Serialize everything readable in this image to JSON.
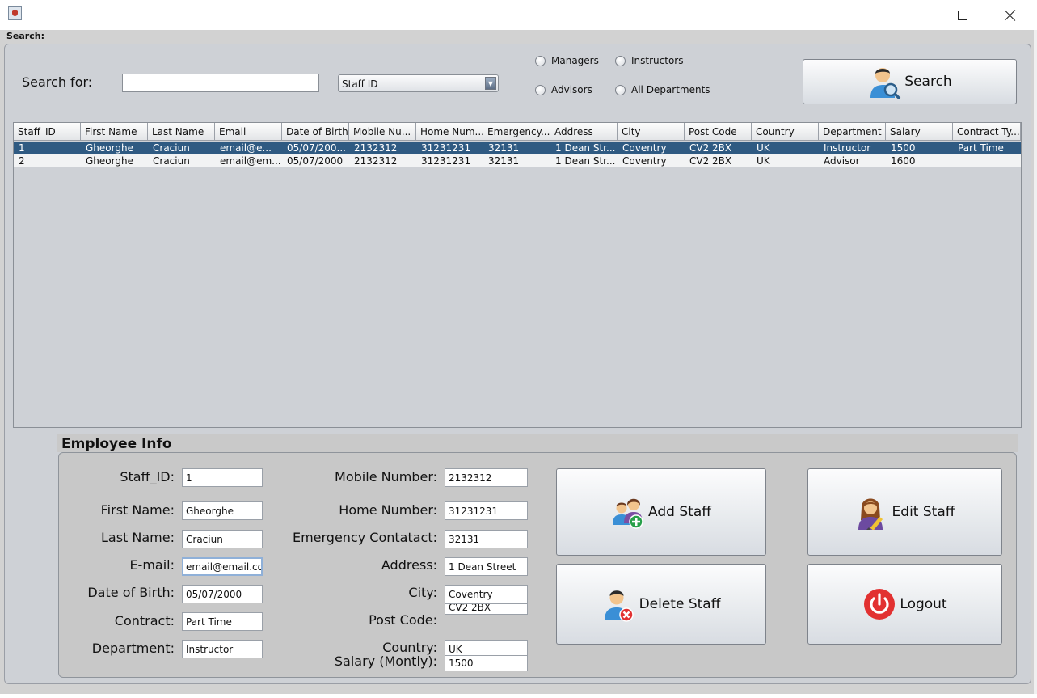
{
  "window": {
    "app_icon": "java-coffee-cup-icon"
  },
  "search": {
    "caption": "Search:",
    "label": "Search for:",
    "input_value": "",
    "field_combo": "Staff ID",
    "radios": [
      "Managers",
      "Instructors",
      "Advisors",
      "All Departments"
    ],
    "button_label": "Search",
    "button_icon": "person-magnifier-icon"
  },
  "table": {
    "columns": [
      "Staff_ID",
      "First Name",
      "Last Name",
      "Email",
      "Date of Birth",
      "Mobile Nu...",
      "Home Num...",
      "Emergency...",
      "Address",
      "City",
      "Post Code",
      "Country",
      "Department",
      "Salary",
      "Contract Ty..."
    ],
    "rows": [
      [
        "1",
        "Gheorghe",
        "Craciun",
        " email@e...",
        " 05/07/200...",
        "2132312",
        "31231231",
        "32131",
        " 1 Dean Str...",
        " Coventry",
        " CV2 2BX",
        " UK",
        "Instructor",
        "1500",
        "Part Time"
      ],
      [
        "2",
        "Gheorghe",
        "Craciun",
        "email@em...",
        "05/07/2000",
        "2132312",
        "31231231",
        "32131",
        " 1 Dean Str...",
        "Coventry",
        "CV2 2BX",
        "UK",
        "Advisor",
        "1600",
        ""
      ]
    ],
    "selected_row": 0
  },
  "employee": {
    "title": "Employee Info",
    "labels": {
      "staff_id": "Staff_ID:",
      "first_name": "First Name:",
      "last_name": "Last Name:",
      "email": "E-mail:",
      "dob": "Date of Birth:",
      "contract": "Contract:",
      "department": "Department:",
      "mobile": "Mobile Number:",
      "home": "Home Number:",
      "emergency": "Emergency Contatact:",
      "address": "Address:",
      "city": "City:",
      "post_code": "Post Code:",
      "country": "Country:",
      "salary": "Salary (Montly):"
    },
    "values": {
      "staff_id": "1",
      "first_name": "Gheorghe",
      "last_name": "Craciun",
      "email": "email@email.com",
      "dob": " 05/07/2000",
      "contract": "Part Time",
      "department": "Instructor",
      "mobile": "2132312",
      "home": "31231231",
      "emergency": "32131",
      "address": " 1 Dean Street",
      "city": " Coventry",
      "post_code": " CV2 2BX",
      "country": " UK",
      "salary": "1500"
    }
  },
  "actions": {
    "add": {
      "label": "Add Staff",
      "icon": "people-add-icon"
    },
    "edit": {
      "label": "Edit Staff",
      "icon": "woman-pencil-icon"
    },
    "delete": {
      "label": "Delete Staff",
      "icon": "person-delete-icon"
    },
    "logout": {
      "label": "Logout",
      "icon": "power-icon"
    }
  },
  "colors": {
    "selection": "#2f5a82",
    "panel": "#ced1d6",
    "logout_red": "#e23131"
  }
}
